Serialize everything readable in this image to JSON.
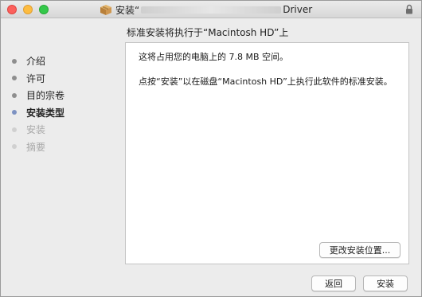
{
  "window": {
    "title_prefix": "安装“",
    "title_suffix": "Driver",
    "icon": "package-icon",
    "lock_icon": "lock-icon"
  },
  "heading": "标准安装将执行于“Macintosh HD”上",
  "sidebar": {
    "steps": [
      {
        "label": "介绍",
        "state": "done"
      },
      {
        "label": "许可",
        "state": "done"
      },
      {
        "label": "目的宗卷",
        "state": "done"
      },
      {
        "label": "安装类型",
        "state": "active"
      },
      {
        "label": "安装",
        "state": "future"
      },
      {
        "label": "摘要",
        "state": "future"
      }
    ]
  },
  "content": {
    "line1": "这将占用您的电脑上的 7.8 MB 空间。",
    "line2": "点按“安装”以在磁盘“Macintosh HD”上执行此软件的标准安装。",
    "change_location_button": "更改安装位置..."
  },
  "footer": {
    "back_button": "返回",
    "install_button": "安装"
  },
  "colors": {
    "active_dot": "#7d92c2",
    "close": "#fc605c",
    "minimize": "#fdbc40",
    "zoom": "#34c84a"
  }
}
